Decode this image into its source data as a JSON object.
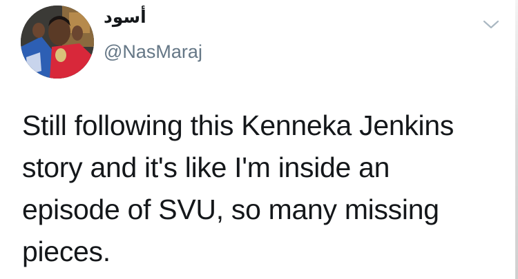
{
  "tweet": {
    "display_name": "أسود",
    "handle": "@NasMaraj",
    "text": "Still following this Kenneka Jenkins\nstory and it's like I'm inside an\nepisode of SVU, so many missing\npieces."
  },
  "icons": {
    "menu": "chevron-down-icon"
  },
  "colors": {
    "text": "#14171a",
    "handle": "#657786",
    "chevron": "#aab8c2"
  }
}
